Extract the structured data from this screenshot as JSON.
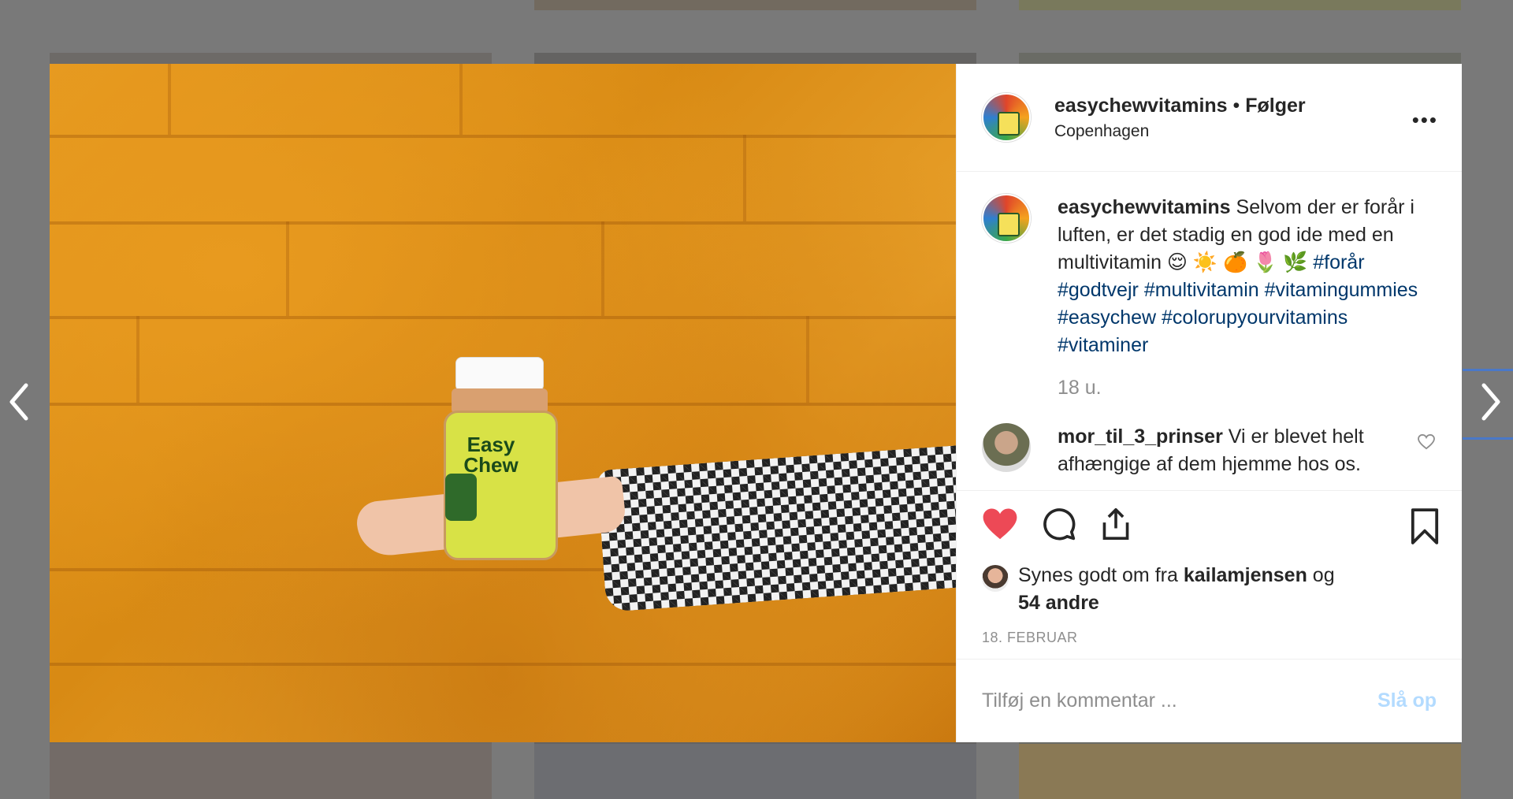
{
  "post": {
    "username": "easychewvitamins",
    "separator": " • ",
    "follow_state": "Følger",
    "location": "Copenhagen",
    "more_label": "•••",
    "caption_user": "easychewvitamins",
    "caption_text": " Selvom der er forår i luften, er det stadig en god ide med en multivitamin 😌 ☀️ 🍊 🌷 🌿 ",
    "hashtags": [
      "#forår",
      "#godtvejr",
      "#multivitamin",
      "#vitamingummies",
      "#easychew",
      "#colorupyourvitamins",
      "#vitaminer"
    ],
    "caption_age": "18 u.",
    "image_brand": "Easy Chew"
  },
  "comments": [
    {
      "username": "mor_til_3_prinser",
      "text": " Vi er blevet helt afhængige af dem hjemme hos os."
    }
  ],
  "likes": {
    "prefix": "Synes godt om fra ",
    "liked_by": "kailamjensen",
    "connector": " og",
    "others": "54 andre"
  },
  "date": "18. FEBRUAR",
  "composer": {
    "placeholder": "Tilføj en kommentar ...",
    "post_label": "Slå op"
  },
  "colors": {
    "like_active": "#ed4956",
    "hashtag": "#00376b",
    "post_disabled": "#b3dbff"
  },
  "icons": [
    "chevron-left-icon",
    "chevron-right-icon",
    "heart-icon",
    "comment-icon",
    "share-icon",
    "bookmark-icon",
    "more-icon"
  ]
}
